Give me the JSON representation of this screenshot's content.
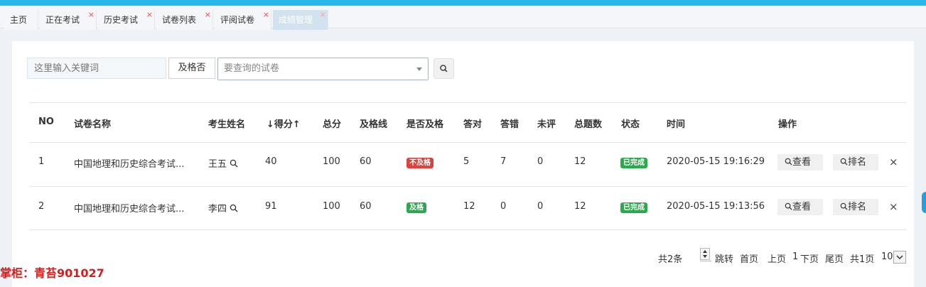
{
  "tabs": [
    {
      "label": "主页",
      "closable": false
    },
    {
      "label": "正在考试",
      "closable": true
    },
    {
      "label": "历史考试",
      "closable": true
    },
    {
      "label": "试卷列表",
      "closable": true
    },
    {
      "label": "评阅试卷",
      "closable": true
    },
    {
      "label": "成绩管理",
      "closable": true,
      "active": true
    }
  ],
  "tab_close_glyph": "×",
  "filters": {
    "keyword_placeholder": "这里输入关键词",
    "pass_select_value": "及格否",
    "paper_placeholder": "要查询的试卷"
  },
  "table": {
    "headers": {
      "no": "NO",
      "paper": "试卷名称",
      "student": "考生姓名",
      "score": "↓得分↑",
      "total": "总分",
      "pass_line": "及格线",
      "passed": "是否及格",
      "correct": "答对",
      "wrong": "答错",
      "unreviewed": "未评",
      "count": "总题数",
      "status": "状态",
      "time": "时间",
      "ops": "操作"
    },
    "rows": [
      {
        "no": "1",
        "paper": "中国地理和历史综合考试...",
        "student": "王五",
        "score": "40",
        "total": "100",
        "pass_line": "60",
        "passed": "不及格",
        "correct": "5",
        "wrong": "7",
        "unreviewed": "0",
        "count": "12",
        "status": "已完成",
        "time": "2020-05-15 19:16:29"
      },
      {
        "no": "2",
        "paper": "中国地理和历史综合考试...",
        "student": "李四",
        "score": "91",
        "total": "100",
        "pass_line": "60",
        "passed": "及格",
        "correct": "12",
        "wrong": "0",
        "unreviewed": "0",
        "count": "12",
        "status": "已完成",
        "time": "2020-05-15 19:13:56"
      }
    ],
    "view_label": "查看",
    "rank_label": "排名",
    "delete_glyph": "×"
  },
  "pagination": {
    "total": "共2条",
    "jump": "跳转",
    "first": "首页",
    "prev": "上页",
    "current": "1",
    "next": "下页",
    "last": "尾页",
    "pages": "共1页",
    "page_size": "10"
  },
  "watermark": "掌柜：青苔901027",
  "colors": {
    "topbar": "#29b6e8",
    "fail_badge": "#d9443f",
    "pass_badge": "#2ea84f",
    "watermark": "#d21f1f"
  }
}
